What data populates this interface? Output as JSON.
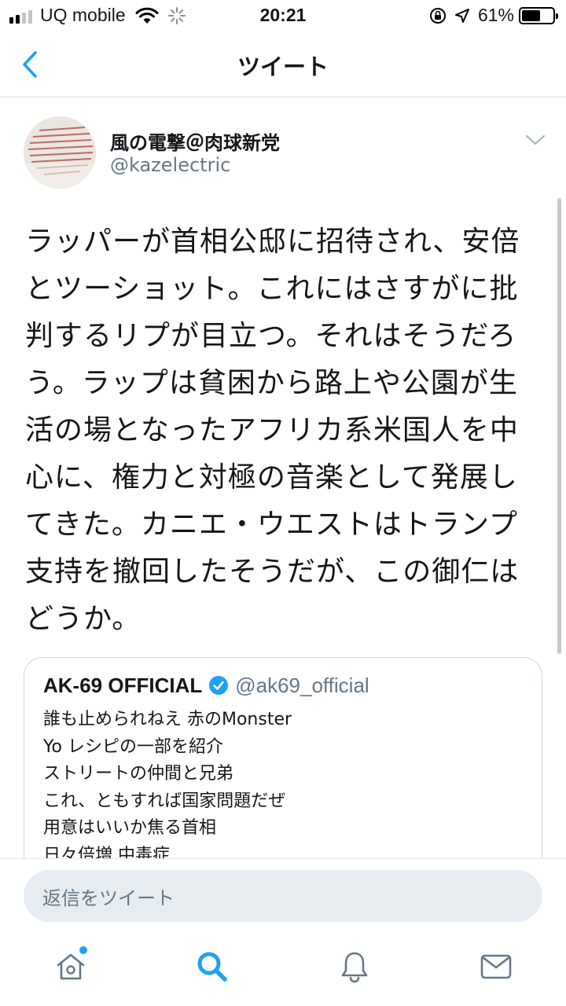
{
  "status_bar": {
    "carrier": "UQ mobile",
    "time": "20:21",
    "battery_percent": "61%",
    "battery_level": 0.61
  },
  "nav": {
    "title": "ツイート"
  },
  "tweet": {
    "author_name": "風の電撃＠肉球新党",
    "author_handle": "@kazelectric",
    "text": "ラッパーが首相公邸に招待され、安倍とツーショット。これにはさすがに批判するリプが目立つ。それはそうだろう。ラップは貧困から路上や公園が生活の場となったアフリカ系米国人を中心に、権力と対極の音楽として発展してきた。カニエ・ウエストはトランプ支持を撤回したそうだが、この御仁はどうか。"
  },
  "quote": {
    "name": "AK-69 OFFICIAL",
    "handle": "@ak69_official",
    "lines": [
      "誰も止められねえ 赤のMonster",
      "Yo レシピの一部を紹介",
      "ストリートの仲間と兄弟",
      "これ、ともすれば国家問題だぜ",
      "用意はいいか焦る首相",
      "日々倍増 中毒症"
    ]
  },
  "reply": {
    "placeholder": "返信をツイート"
  },
  "tabs": [
    "home-icon",
    "search-icon",
    "bell-icon",
    "mail-icon"
  ],
  "colors": {
    "accent": "#1da1f2",
    "secondary_text": "#657786",
    "divider": "#e1e8ed"
  }
}
